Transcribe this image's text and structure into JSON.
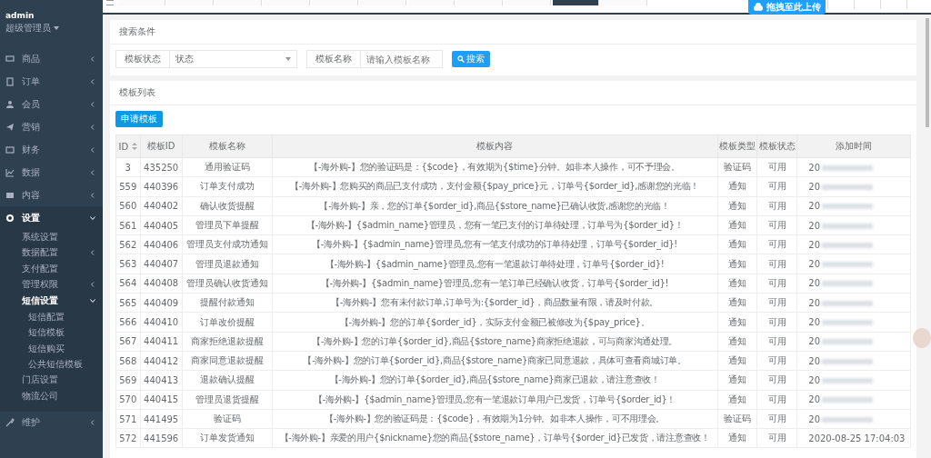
{
  "sidebar": {
    "user": {
      "name": "admin",
      "role": "超级管理员"
    },
    "items": [
      {
        "label": "商品",
        "expanded": false
      },
      {
        "label": "订单",
        "expanded": false
      },
      {
        "label": "会员",
        "expanded": false
      },
      {
        "label": "营销",
        "expanded": false
      },
      {
        "label": "财务",
        "expanded": false
      },
      {
        "label": "数据",
        "expanded": false
      },
      {
        "label": "内容",
        "expanded": false
      },
      {
        "label": "设置",
        "expanded": true,
        "children": [
          {
            "label": "系统设置"
          },
          {
            "label": "数据配置",
            "expanded": false
          },
          {
            "label": "支付配置"
          },
          {
            "label": "管理权限",
            "expanded": false
          },
          {
            "label": "短信设置",
            "expanded": true,
            "children": [
              {
                "label": "短信配置"
              },
              {
                "label": "短信模板"
              },
              {
                "label": "短信购买"
              },
              {
                "label": "公共短信模板"
              }
            ]
          },
          {
            "label": "门店设置"
          },
          {
            "label": "物流公司"
          }
        ]
      },
      {
        "label": "维护",
        "expanded": false
      }
    ]
  },
  "tabs": [
    {
      "selected": false
    },
    {
      "selected": false
    },
    {
      "selected": false
    },
    {
      "selected": false
    },
    {
      "selected": false
    },
    {
      "selected": false
    },
    {
      "selected": false
    },
    {
      "selected": false
    },
    {
      "selected": false
    },
    {
      "selected": true
    },
    {
      "selected": false
    }
  ],
  "upload_badge": "拖拽至此上传",
  "search": {
    "title": "搜索条件",
    "fields": [
      {
        "kind": "select",
        "label": "模板状态",
        "value": "状态"
      },
      {
        "kind": "input",
        "label": "模板名称",
        "placeholder": "请输入模板名称"
      }
    ],
    "button": "搜索"
  },
  "list": {
    "title": "模板列表",
    "button": "申请模板",
    "columns": [
      {
        "label": "ID",
        "sortable": true
      },
      {
        "label": "模板ID",
        "sortable": false
      },
      {
        "label": "模板名称",
        "sortable": false
      },
      {
        "label": "模板内容",
        "sortable": false
      },
      {
        "label": "模板类型",
        "sortable": false
      },
      {
        "label": "模板状态",
        "sortable": false
      },
      {
        "label": "添加时间",
        "sortable": false
      }
    ],
    "rows": [
      {
        "id": "3",
        "template_id": "435250",
        "name": "通用验证码",
        "content": "【-海外购-】您的验证码是：{$code}，有效期为{$time}分钟。如非本人操作，可不予理会。",
        "type": "验证码",
        "status": "可用",
        "time": "20",
        "blurred": true
      },
      {
        "id": "559",
        "template_id": "440396",
        "name": "订单支付成功",
        "content": "【-海外购-】您购买的商品已支付成功，支付金额{$pay_price}元，订单号{$order_id},感谢您的光临！",
        "type": "通知",
        "status": "可用",
        "time": "20",
        "blurred": true
      },
      {
        "id": "560",
        "template_id": "440402",
        "name": "确认收货提醒",
        "content": "【-海外购-】亲，您的订单{$order_id},商品{$store_name}已确认收货,感谢您的光临！",
        "type": "通知",
        "status": "可用",
        "time": "20",
        "blurred": true
      },
      {
        "id": "561",
        "template_id": "440405",
        "name": "管理员下单提醒",
        "content": "【-海外购-】{$admin_name}管理员，您有一笔已支付的订单待处理，订单号为{$order_id}！",
        "type": "通知",
        "status": "可用",
        "time": "20",
        "blurred": true
      },
      {
        "id": "562",
        "template_id": "440406",
        "name": "管理员支付成功通知",
        "content": "【-海外购-】{$admin_name}管理员,您有一笔支付成功的订单待处理，订单号{$order_id}!",
        "type": "通知",
        "status": "可用",
        "time": "20",
        "blurred": true
      },
      {
        "id": "563",
        "template_id": "440407",
        "name": "管理员退款通知",
        "content": "【-海外购-】{$admin_name}管理员,您有一笔退款订单待处理，订单号{$order_id}!",
        "type": "通知",
        "status": "可用",
        "time": "20",
        "blurred": true
      },
      {
        "id": "564",
        "template_id": "440408",
        "name": "管理员确认收货通知",
        "content": "【-海外购-】{$admin_name}管理员,您有一笔订单已经确认收货，订单号{$order_id}!",
        "type": "通知",
        "status": "可用",
        "time": "20",
        "blurred": true
      },
      {
        "id": "565",
        "template_id": "440409",
        "name": "提醒付款通知",
        "content": "【-海外购-】您有未付款订单,订单号为:{$order_id}，商品数量有限，请及时付款。",
        "type": "通知",
        "status": "可用",
        "time": "20",
        "blurred": true
      },
      {
        "id": "566",
        "template_id": "440410",
        "name": "订单改价提醒",
        "content": "【-海外购-】您的订单{$order_id}，实际支付金额已被修改为{$pay_price}。",
        "type": "通知",
        "status": "可用",
        "time": "20",
        "blurred": true
      },
      {
        "id": "567",
        "template_id": "440411",
        "name": "商家拒绝退款提醒",
        "content": "【-海外购-】您的订单{$order_id},商品{$store_name}商家拒绝退款，可与商家沟通处理。",
        "type": "通知",
        "status": "可用",
        "time": "20",
        "blurred": true
      },
      {
        "id": "568",
        "template_id": "440412",
        "name": "商家同意退款提醒",
        "content": "【-海外购-】您的订单{$order_id},商品{$store_name}商家已同意退款，具体可查看商城订单。",
        "type": "通知",
        "status": "可用",
        "time": "20",
        "blurred": true
      },
      {
        "id": "569",
        "template_id": "440413",
        "name": "退款确认提醒",
        "content": "【-海外购-】您的订单{$order_id},商品{$store_name}商家已退款，请注意查收！",
        "type": "通知",
        "status": "可用",
        "time": "20",
        "blurred": true
      },
      {
        "id": "570",
        "template_id": "440415",
        "name": "管理员退货提醒",
        "content": "【-海外购-】{$admin_name}管理员,您有一笔退款订单用户已发货，订单号{$order_id}！",
        "type": "通知",
        "status": "可用",
        "time": "20",
        "blurred": true
      },
      {
        "id": "571",
        "template_id": "441495",
        "name": "验证码",
        "content": "【-海外购-】您的验证码是：{$code}，有效期为1分钟。如非本人操作，可不用理会。",
        "type": "验证码",
        "status": "可用",
        "time": "20",
        "blurred": true
      },
      {
        "id": "572",
        "template_id": "441596",
        "name": "订单发货通知",
        "content": "【-海外购-】亲爱的用户{$nickname}您的商品{$store_name}，订单号{$order_id}已发货，请注意查收！",
        "type": "通知",
        "status": "可用",
        "time": "2020-08-25 17:04:03",
        "blurred": false
      }
    ]
  }
}
